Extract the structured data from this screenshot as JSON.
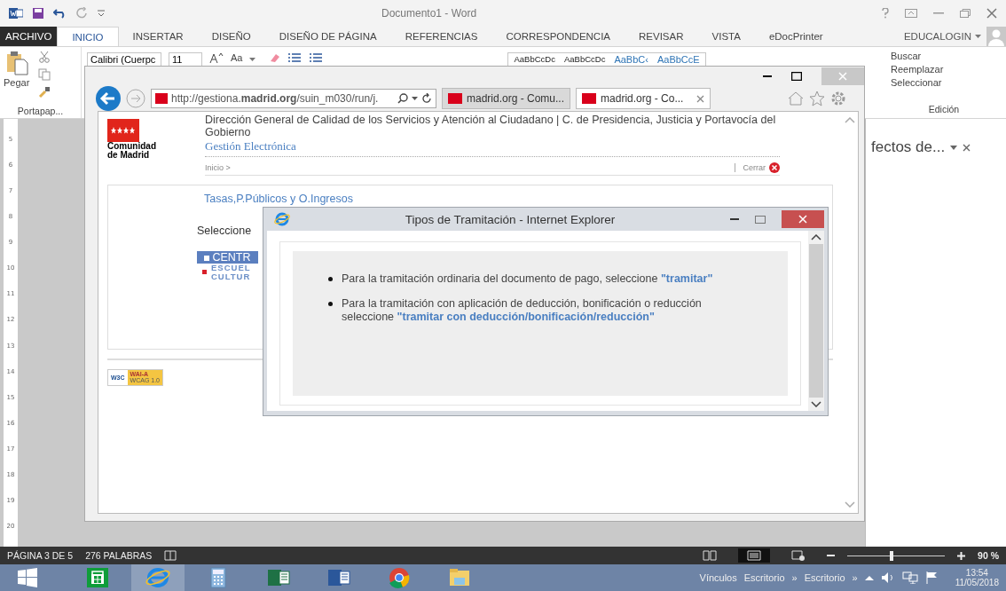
{
  "word": {
    "title": "Documento1 - Word",
    "account": "EDUCALOGIN",
    "ribbon_tabs": [
      {
        "label": "ARCHIVO",
        "kind": "file",
        "selected": false
      },
      {
        "label": "INICIO",
        "kind": "tab",
        "selected": true
      },
      {
        "label": "INSERTAR",
        "kind": "tab",
        "selected": false
      },
      {
        "label": "DISEÑO",
        "kind": "tab",
        "selected": false
      },
      {
        "label": "DISEÑO DE PÁGINA",
        "kind": "tab",
        "selected": false
      },
      {
        "label": "REFERENCIAS",
        "kind": "tab",
        "selected": false
      },
      {
        "label": "CORRESPONDENCIA",
        "kind": "tab",
        "selected": false
      },
      {
        "label": "REVISAR",
        "kind": "tab",
        "selected": false
      },
      {
        "label": "VISTA",
        "kind": "tab",
        "selected": false
      },
      {
        "label": "eDocPrinter",
        "kind": "tab",
        "selected": false
      }
    ],
    "clipboard": {
      "paste": "Pegar",
      "group": "Portapap..."
    },
    "font": {
      "name": "Calibri (Cuerpc",
      "size": "11",
      "case_button": "Aa"
    },
    "styles": [
      "AaBbCcDc",
      "AaBbCcDc",
      "AaBbC‹",
      "AaBbCcE"
    ],
    "editing": {
      "items": [
        "Buscar",
        "Reemplazar",
        "Seleccionar"
      ],
      "group": "Edición"
    },
    "ruler_numbers": [
      "5",
      "6",
      "7",
      "8",
      "9",
      "10",
      "11",
      "12",
      "13",
      "14",
      "15",
      "16",
      "17",
      "18",
      "19",
      "20"
    ],
    "side_pane_title": "fectos de...",
    "status_bar": {
      "page": "PÁGINA 3 DE 5",
      "words": "276 PALABRAS",
      "views": [
        {
          "kind": "read",
          "selected": false
        },
        {
          "kind": "print",
          "selected": true
        },
        {
          "kind": "web",
          "selected": false
        }
      ],
      "zoom_slider": {
        "level": 0.45
      },
      "zoom": "90 %"
    }
  },
  "browser": {
    "address": "http://gestiona.**madrid.org**/suin_m030/run/j.",
    "tabs": [
      {
        "label": "madrid.org - Comu...",
        "selected": false
      },
      {
        "label": "madrid.org - Co...",
        "selected": true
      }
    ],
    "page": {
      "logo_text": "Comunidad de Madrid",
      "heading": "Dirección General de Calidad de los Servicios y Atención al Ciudadano | C. de Presidencia, Justicia y Portavocía del Gobierno",
      "subtitle": "Gestión Electrónica",
      "breadcrumb": "Inicio >",
      "close_link": "Cerrar",
      "section_title": "Tasas,P.Públicos y O.Ingresos",
      "prompt": "Seleccione",
      "menu_header": "CENTR",
      "menu_items": [
        "ESCUEL",
        "CULTUR"
      ],
      "badge": {
        "w3c": "W3C",
        "level": "WAI-A",
        "standard": "WCAG 1.0"
      }
    }
  },
  "dialog": {
    "title": "Tipos de Tramitación - Internet Explorer",
    "items": [
      {
        "text": "Para la tramitación ordinaria del documento de pago, seleccione",
        "link": "\"tramitar\""
      },
      {
        "text": "Para la tramitación con aplicación de deducción, bonificación o reducción seleccione",
        "link": "\"tramitar con deducción/bonificación/reducción\""
      }
    ]
  },
  "taskbar": {
    "apps": [
      {
        "kind": "store",
        "selected": false
      },
      {
        "kind": "ie",
        "selected": true
      },
      {
        "kind": "calculator",
        "selected": false
      },
      {
        "kind": "excel",
        "selected": false
      },
      {
        "kind": "word",
        "selected": false
      },
      {
        "kind": "chrome",
        "selected": false
      },
      {
        "kind": "explorer",
        "selected": false
      }
    ],
    "toolbars": [
      "Vínculos",
      "Escritorio",
      "»",
      "Escritorio",
      "»"
    ],
    "time": "13:54",
    "date": "11/05/2018"
  }
}
